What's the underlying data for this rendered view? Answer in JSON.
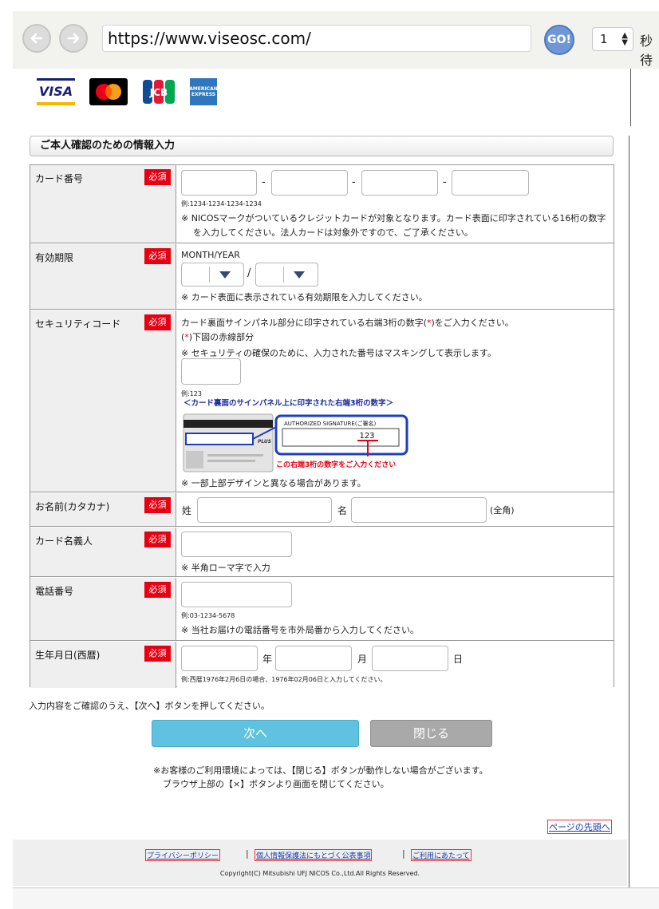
{
  "browser": {
    "url": "https://www.viseosc.com/",
    "go_label": "GO!",
    "seconds_value": "1",
    "seconds_label": "秒待"
  },
  "logos": {
    "visa": "VISA",
    "mastercard": "",
    "jcb": "JCB",
    "amex": "AMERICAN EXPRESS"
  },
  "section_title": "ご本人確認のための情報入力",
  "required_label": "必須",
  "fields": {
    "card_number": {
      "label": "カード番号",
      "separator": "-",
      "example": "例:1234-1234-1234-1234",
      "note_line1": "※ NICOSマークがついているクレジットカードが対象となります。カード表面に印字されている16桁の数字",
      "note_line2": "を入力してください。法人カードは対象外ですので、ご了承ください。"
    },
    "expiry": {
      "label": "有効期限",
      "format": "MONTH/YEAR",
      "slash": "/",
      "note": "※ カード表面に表示されている有効期限を入力してください。"
    },
    "security_code": {
      "label": "セキュリティコード",
      "desc1_pre": "カード裏面サインパネル部分に印字されている右端3桁の数字(",
      "star": "*",
      "desc1_post": ")をご入力ください。",
      "desc2_pre": "(",
      "desc2_post": ")下図の赤線部分",
      "desc3": "※ セキュリティの確保のために、入力された番号はマスキングして表示します。",
      "example": "例:123",
      "figure_title": "＜カード裏面のサインパネル上に印字された右端3桁の数字＞",
      "figure_sig": "AUTHORIZED SIGNATURE(ご署名)",
      "figure_code": "123",
      "figure_caption": "この右端3桁の数字をご入力ください",
      "figure_plus": "PLUS",
      "note": "※ 一部上部デザインと異なる場合があります。"
    },
    "name_kana": {
      "label": "お名前(カタカナ)",
      "sei": "姓",
      "mei": "名",
      "zenkaku": "(全角)"
    },
    "card_holder": {
      "label": "カード名義人",
      "note": "※ 半角ローマ字で入力"
    },
    "phone": {
      "label": "電話番号",
      "example": "例:03-1234-5678",
      "note": "※ 当社お届けの電話番号を市外局番から入力してください。"
    },
    "birthdate": {
      "label": "生年月日(西暦)",
      "year": "年",
      "month": "月",
      "day": "日",
      "example": "例:西暦1976年2月6日の場合、1976年02月06日と入力してください。"
    }
  },
  "instruction": "入力内容をご確認のうえ、【次へ】ボタンを押してください。",
  "buttons": {
    "next": "次へ",
    "close": "閉じる"
  },
  "notes": {
    "line1": "※お客様のご利用環境によっては、【閉じる】ボタンが動作しない場合がございます。",
    "line2": "ブラウザ上部の【×】ボタンより画面を閉じてください。"
  },
  "page_top": "ページの先頭へ",
  "footer": {
    "privacy": "プライバシーポリシー",
    "personal_info": "個人情報保護法にもとづく公表事項",
    "terms": "ご利用にあたって",
    "separator": "|",
    "copyright": "Copyright(C) Mitsubishi UFJ NICOS Co.,Ltd.All Rights Reserved."
  }
}
